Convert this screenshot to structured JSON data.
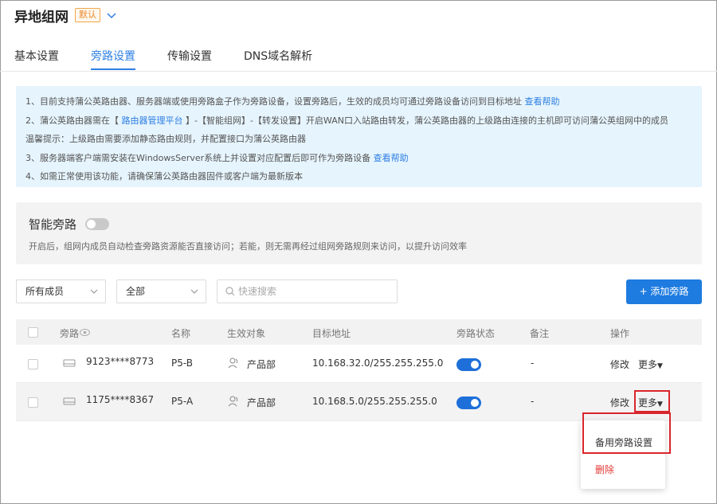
{
  "header": {
    "title": "异地组网",
    "badge": "默认"
  },
  "tabs": [
    {
      "label": "基本设置"
    },
    {
      "label": "旁路设置"
    },
    {
      "label": "传输设置"
    },
    {
      "label": "DNS域名解析"
    }
  ],
  "notice": {
    "line1": "1、目前支持蒲公英路由器、服务器端或使用旁路盒子作为旁路设备，设置旁路后，生效的成员均可通过旁路设备访问到目标地址",
    "line1_link": "查看帮助",
    "line2a": "2、蒲公英路由器需在【",
    "line2_link": "路由器管理平台",
    "line2b": "】-【智能组网】-【转发设置】开启WAN口入站路由转发，蒲公英路由器的上级路由连接的主机即可访问蒲公英组网中的成员",
    "line3": "温馨提示：上级路由需要添加静态路由规则，并配置接口为蒲公英路由器",
    "line4": "3、服务器端客户端需安装在WindowsServer系统上并设置对应配置后即可作为旁路设备",
    "line4_link": "查看帮助",
    "line5": "4、如需正常使用该功能，请确保蒲公英路由器固件或客户端为最新版本"
  },
  "smart": {
    "title": "智能旁路",
    "enabled": false,
    "desc": "开启后，组网内成员自动检查旁路资源能否直接访问；若能，则无需再经过组网旁路规则来访问，以提升访问效率"
  },
  "filters": {
    "member": "所有成员",
    "status": "全部",
    "search_placeholder": "快速搜索",
    "add_label": "+ 添加旁路"
  },
  "table": {
    "headers": [
      "旁路",
      "名称",
      "生效对象",
      "目标地址",
      "旁路状态",
      "备注",
      "操作"
    ],
    "rows": [
      {
        "device": "9123****8773",
        "name": "P5-B",
        "target": "产品部",
        "address": "10.168.32.0/255.255.255.0",
        "enabled": true,
        "note": "-",
        "edit": "修改",
        "more": "更多"
      },
      {
        "device": "1175****8367",
        "name": "P5-A",
        "target": "产品部",
        "address": "10.168.5.0/255.255.255.0",
        "enabled": true,
        "note": "-",
        "edit": "修改",
        "more": "更多"
      }
    ]
  },
  "dropdown": {
    "items": [
      "备用旁路设置",
      "删除"
    ]
  },
  "colors": {
    "accent": "#1e7be0",
    "highlight": "#d9262c",
    "danger": "#e53935"
  }
}
